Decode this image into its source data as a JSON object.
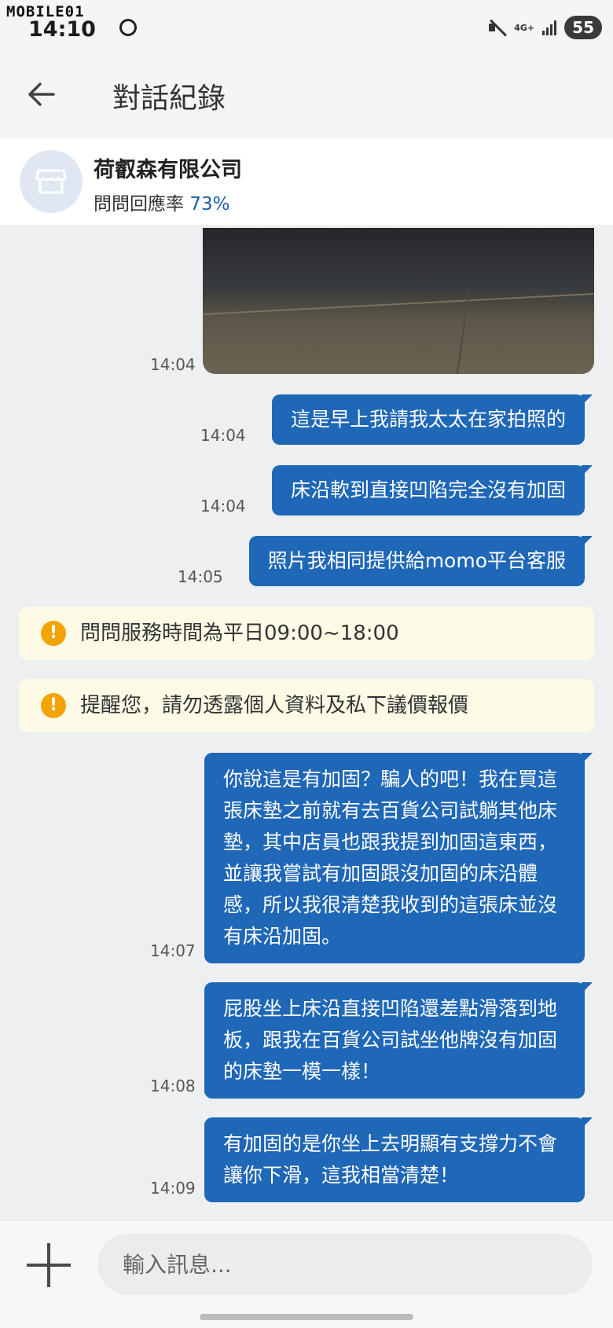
{
  "status_bar": {
    "brand": "MOBILE01",
    "time": "14:10",
    "network": "4G+",
    "battery": "55"
  },
  "header": {
    "title": "對話紀錄"
  },
  "shop": {
    "name": "荷叡森有限公司",
    "rate_label": "問問回應率",
    "rate_value": "73%"
  },
  "messages": [
    {
      "type": "image",
      "time": "14:04"
    },
    {
      "type": "text",
      "text": "這是早上我請我太太在家拍照的",
      "time": "14:04"
    },
    {
      "type": "text",
      "text": "床沿軟到直接凹陷完全沒有加固",
      "time": "14:04"
    },
    {
      "type": "text",
      "text": "照片我相同提供給momo平台客服",
      "time": "14:05"
    },
    {
      "type": "notice",
      "text": "問問服務時間為平日09:00~18:00"
    },
    {
      "type": "notice",
      "text": "提醒您，請勿透露個人資料及私下議價報價"
    },
    {
      "type": "text",
      "text": "你說這是有加固？騙人的吧！我在買這張床墊之前就有去百貨公司試躺其他床墊，其中店員也跟我提到加固這東西，並讓我嘗試有加固跟沒加固的床沿體感，所以我很清楚我收到的這張床並沒有床沿加固。",
      "time": "14:07"
    },
    {
      "type": "text",
      "text": "屁股坐上床沿直接凹陷還差點滑落到地板，跟我在百貨公司試坐他牌沒有加固的床墊一模一樣！",
      "time": "14:08"
    },
    {
      "type": "text",
      "text": "有加固的是你坐上去明顯有支撐力不會讓你下滑，這我相當清楚！",
      "time": "14:09"
    }
  ],
  "composer": {
    "placeholder": "輸入訊息..."
  },
  "colors": {
    "bubble": "#1f67b7",
    "accent": "#1d5ea8",
    "warning": "#f5a300"
  }
}
